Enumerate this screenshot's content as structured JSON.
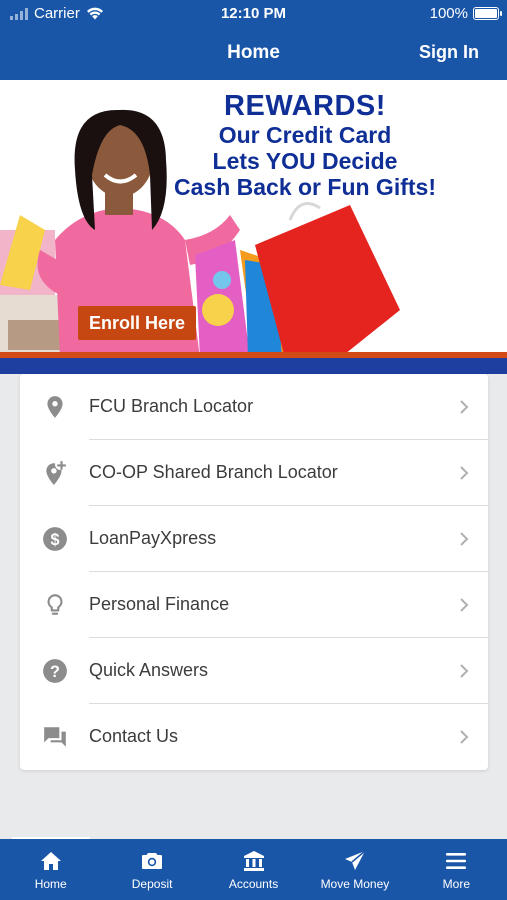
{
  "status_bar": {
    "carrier": "Carrier",
    "time": "12:10 PM",
    "battery": "100%"
  },
  "nav": {
    "title": "Home",
    "sign_in": "Sign In"
  },
  "banner": {
    "line1": "REWARDS!",
    "line2": "Our Credit Card",
    "line3": "Lets YOU Decide",
    "line4": "Cash Back or Fun Gifts!",
    "enroll_button": "Enroll Here"
  },
  "menu": {
    "items": [
      {
        "label": "FCU Branch Locator",
        "icon": "location-pin-icon"
      },
      {
        "label": "CO-OP Shared Branch Locator",
        "icon": "add-location-icon"
      },
      {
        "label": "LoanPayXpress",
        "icon": "dollar-circle-icon"
      },
      {
        "label": "Personal Finance",
        "icon": "lightbulb-icon"
      },
      {
        "label": "Quick Answers",
        "icon": "question-circle-icon"
      },
      {
        "label": "Contact Us",
        "icon": "chat-bubbles-icon"
      }
    ]
  },
  "tabbar": {
    "tabs": [
      {
        "label": "Home",
        "icon": "home-icon"
      },
      {
        "label": "Deposit",
        "icon": "camera-icon"
      },
      {
        "label": "Accounts",
        "icon": "bank-icon"
      },
      {
        "label": "Move Money",
        "icon": "paper-plane-icon"
      },
      {
        "label": "More",
        "icon": "hamburger-menu-icon"
      }
    ],
    "active": "Home"
  },
  "colors": {
    "brand_blue": "#1a56a8",
    "banner_navy": "#0f2f96",
    "accent_orange": "#c74712",
    "icon_gray": "#8c8c8c"
  }
}
